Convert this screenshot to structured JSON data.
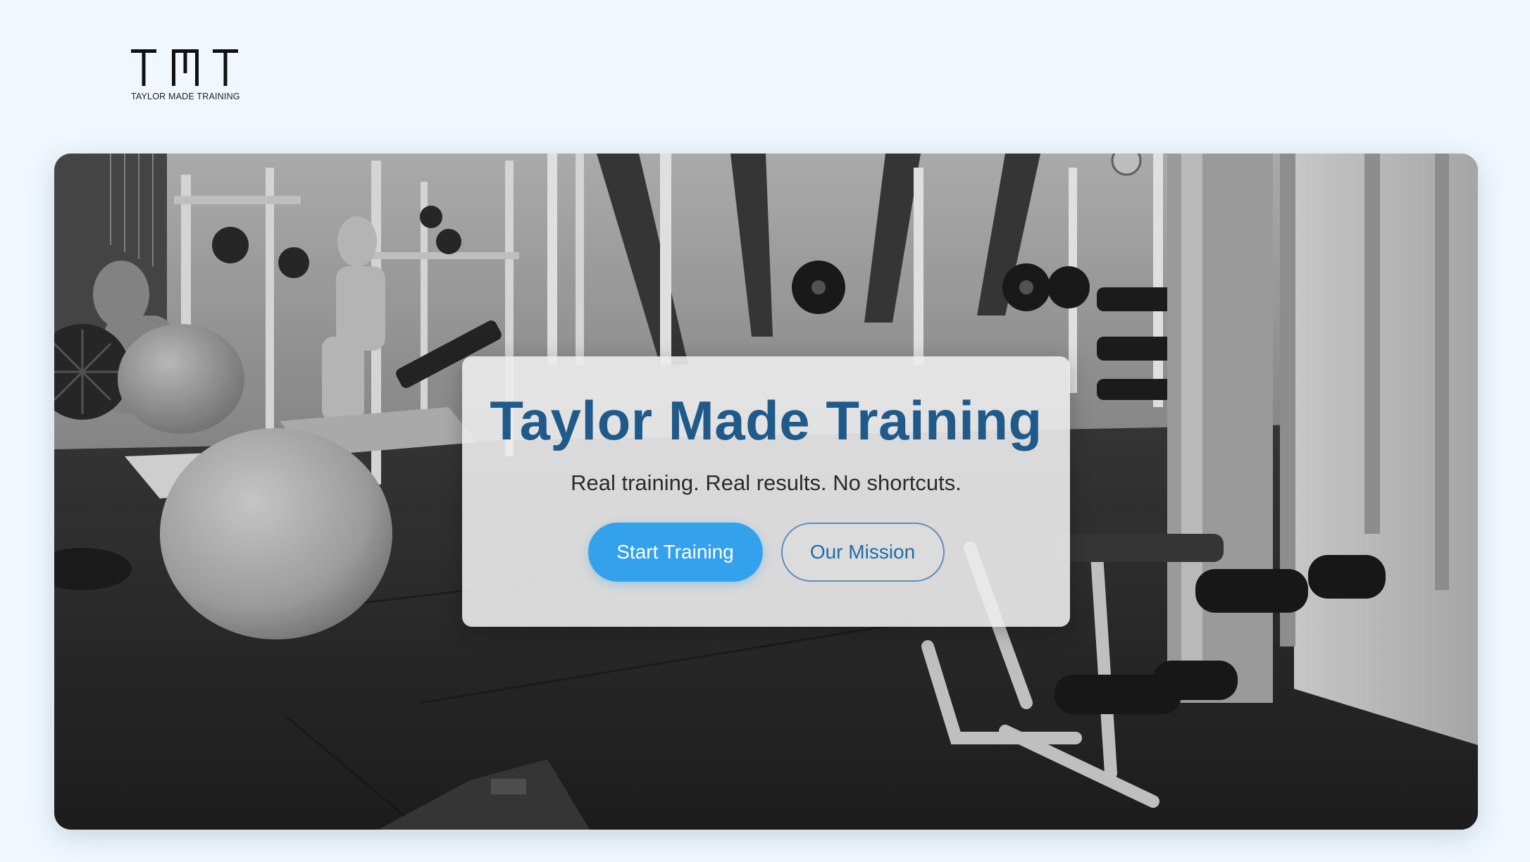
{
  "brand": {
    "logo_letters": "TMT",
    "logo_subtitle": "TAYLOR MADE TRAINING"
  },
  "hero": {
    "background_image": "gym-interior-photo",
    "title": "Taylor Made Training",
    "tagline": "Real training. Real results. No shortcuts.",
    "primary_button": "Start Training",
    "secondary_button": "Our Mission"
  },
  "colors": {
    "page_background": "#f0f7fe",
    "title": "#1f5a8a",
    "primary_button": "#34a1ec",
    "secondary_button_text": "#1f6ea8"
  }
}
